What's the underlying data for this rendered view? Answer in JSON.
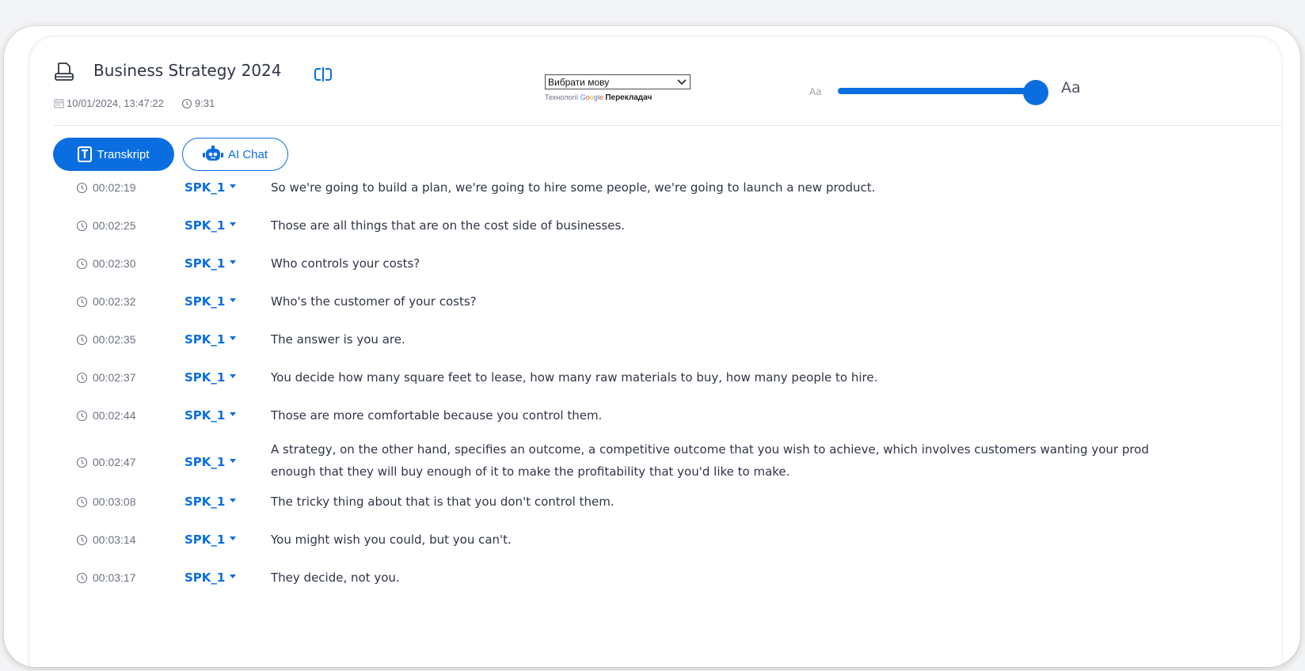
{
  "header": {
    "title": "Business Strategy 2024",
    "date": "10/01/2024, 13:47:22",
    "duration": "9:31"
  },
  "translate": {
    "select_label": "Вибрати мову",
    "credit_prefix": "Технології",
    "credit_brand": [
      "G",
      "o",
      "o",
      "g",
      "l",
      "e"
    ],
    "credit_suffix": "Перекладач"
  },
  "font_size": {
    "small_label": "Aa",
    "large_label": "Aa",
    "value_fraction": 1.0
  },
  "tabs": {
    "transkript": "Transkript",
    "ai_chat": "AI Chat"
  },
  "colors": {
    "accent": "#0a6ee0"
  },
  "transcript": [
    {
      "time": "00:02:19",
      "speaker": "SPK_1",
      "text": [
        "So we're going to build a plan, we're going to hire some people, we're going to launch a new product."
      ]
    },
    {
      "time": "00:02:25",
      "speaker": "SPK_1",
      "text": [
        "Those are all things that are on the cost side of businesses."
      ]
    },
    {
      "time": "00:02:30",
      "speaker": "SPK_1",
      "text": [
        "Who controls your costs?"
      ]
    },
    {
      "time": "00:02:32",
      "speaker": "SPK_1",
      "text": [
        "Who's the customer of your costs?"
      ]
    },
    {
      "time": "00:02:35",
      "speaker": "SPK_1",
      "text": [
        "The answer is you are."
      ]
    },
    {
      "time": "00:02:37",
      "speaker": "SPK_1",
      "text": [
        "You decide how many square feet to lease, how many raw materials to buy, how many people to hire."
      ]
    },
    {
      "time": "00:02:44",
      "speaker": "SPK_1",
      "text": [
        "Those are more comfortable because you control them."
      ]
    },
    {
      "time": "00:02:47",
      "speaker": "SPK_1",
      "text": [
        "A strategy, on the other hand, specifies an outcome, a competitive outcome that you wish to achieve, which involves customers wanting your prod",
        "enough that they will buy enough of it to make the profitability that you'd like to make."
      ]
    },
    {
      "time": "00:03:08",
      "speaker": "SPK_1",
      "text": [
        "The tricky thing about that is that you don't control them."
      ]
    },
    {
      "time": "00:03:14",
      "speaker": "SPK_1",
      "text": [
        "You might wish you could, but you can't."
      ]
    },
    {
      "time": "00:03:17",
      "speaker": "SPK_1",
      "text": [
        "They decide, not you."
      ]
    }
  ]
}
